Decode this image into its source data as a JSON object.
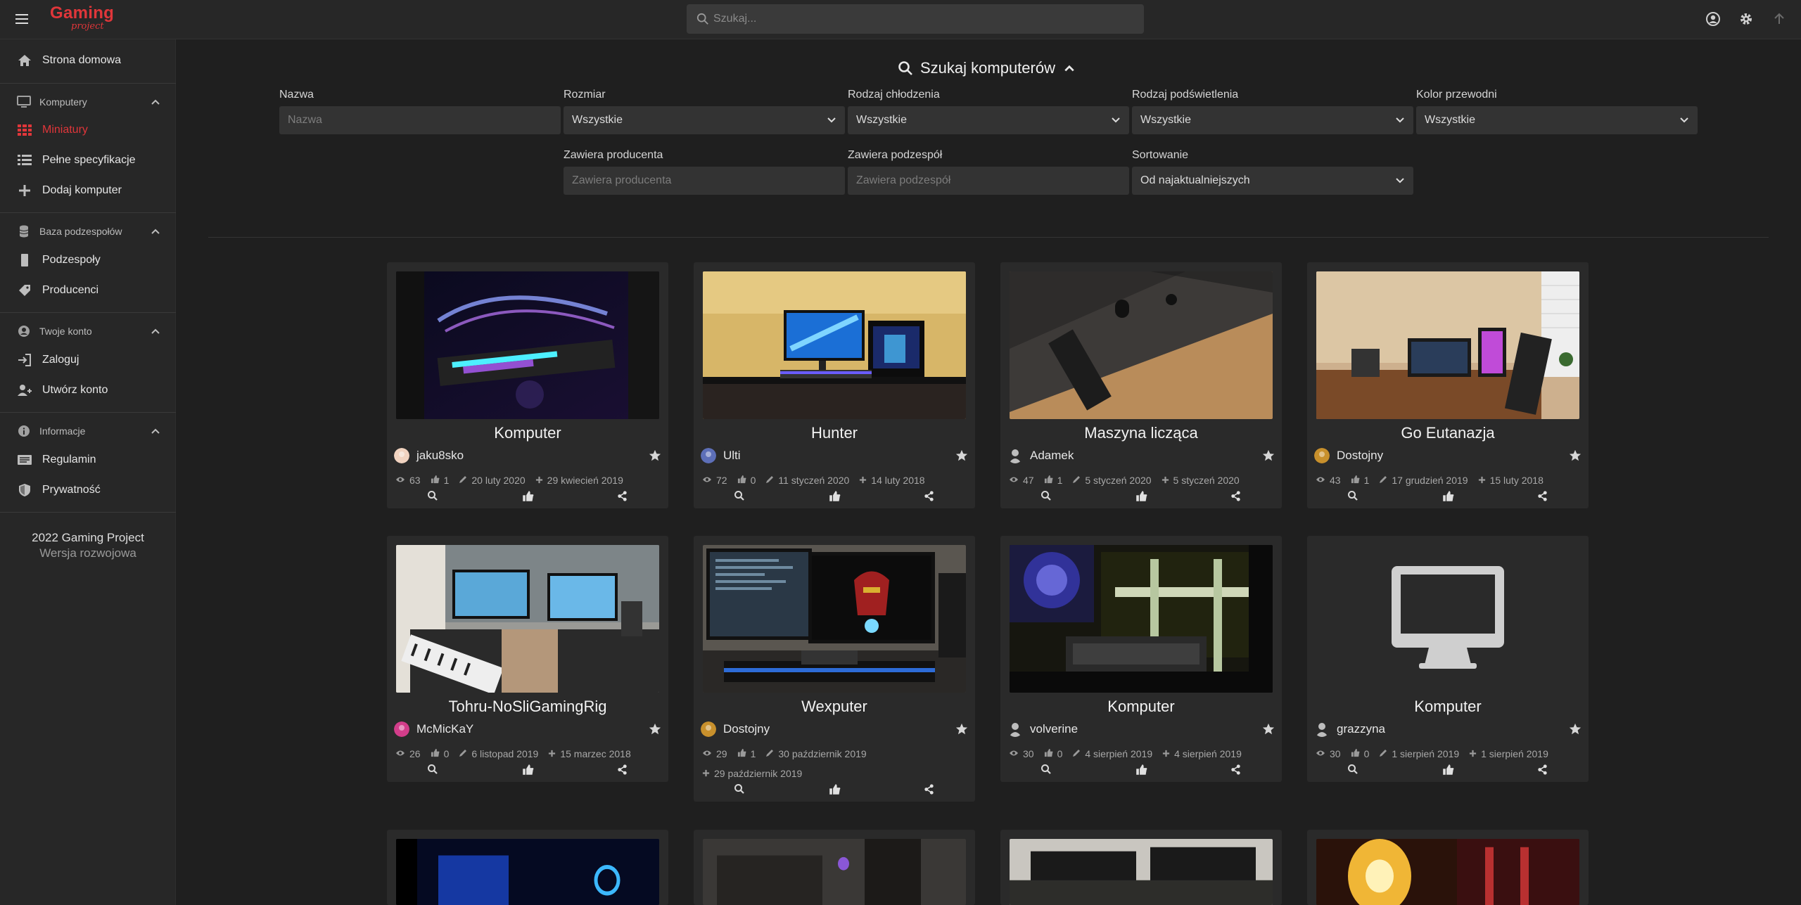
{
  "app": {
    "logo_line1": "Gaming",
    "logo_line2": "project",
    "accent": "#e0363a"
  },
  "search": {
    "placeholder": "Szukaj..."
  },
  "topbar_icons": [
    "user-circle-icon",
    "gear-icon",
    "arrow-up-icon"
  ],
  "sidebar": {
    "home": "Strona domowa",
    "sections": [
      {
        "label": "Komputery",
        "icon": "monitor-icon",
        "items": [
          {
            "label": "Miniatury",
            "icon": "grid-icon",
            "active": true
          },
          {
            "label": "Pełne specyfikacje",
            "icon": "list-icon",
            "active": false
          },
          {
            "label": "Dodaj komputer",
            "icon": "plus-icon",
            "active": false
          }
        ]
      },
      {
        "label": "Baza podzespołów",
        "icon": "database-icon",
        "items": [
          {
            "label": "Podzespoły",
            "icon": "memory-icon",
            "active": false
          },
          {
            "label": "Producenci",
            "icon": "tag-icon",
            "active": false
          }
        ]
      },
      {
        "label": "Twoje konto",
        "icon": "user-circle-icon",
        "items": [
          {
            "label": "Zaloguj",
            "icon": "login-icon",
            "active": false
          },
          {
            "label": "Utwórz konto",
            "icon": "user-plus-icon",
            "active": false
          }
        ]
      },
      {
        "label": "Informacje",
        "icon": "info-icon",
        "items": [
          {
            "label": "Regulamin",
            "icon": "document-icon",
            "active": false
          },
          {
            "label": "Prywatność",
            "icon": "shield-icon",
            "active": false
          }
        ]
      }
    ],
    "footer_line1": "2022 Gaming Project",
    "footer_line2": "Wersja rozwojowa"
  },
  "filters": {
    "title": "Szukaj komputerów",
    "name_label": "Nazwa",
    "name_placeholder": "Nazwa",
    "size_label": "Rozmiar",
    "size_value": "Wszystkie",
    "cooling_label": "Rodzaj chłodzenia",
    "cooling_value": "Wszystkie",
    "lighting_label": "Rodzaj podświetlenia",
    "lighting_value": "Wszystkie",
    "color_label": "Kolor przewodni",
    "color_value": "Wszystkie",
    "manufacturer_label": "Zawiera producenta",
    "manufacturer_placeholder": "Zawiera producenta",
    "component_label": "Zawiera podzespół",
    "component_placeholder": "Zawiera podzespół",
    "sort_label": "Sortowanie",
    "sort_value": "Od najaktualniejszych"
  },
  "cards": [
    {
      "title": "Komputer",
      "author": "jaku8sko",
      "views": "63",
      "likes": "1",
      "edited": "20 luty 2020",
      "created": "29 kwiecień 2019"
    },
    {
      "title": "Hunter",
      "author": "Ulti",
      "views": "72",
      "likes": "0",
      "edited": "11 styczeń 2020",
      "created": "14 luty 2018"
    },
    {
      "title": "Maszyna licząca",
      "author": "Adamek",
      "views": "47",
      "likes": "1",
      "edited": "5 styczeń 2020",
      "created": "5 styczeń 2020"
    },
    {
      "title": "Go Eutanazja",
      "author": "Dostojny",
      "views": "43",
      "likes": "1",
      "edited": "17 grudzień 2019",
      "created": "15 luty 2018"
    },
    {
      "title": "Tohru-NoSliGamingRig",
      "author": "McMicKaY",
      "views": "26",
      "likes": "0",
      "edited": "6 listopad 2019",
      "created": "15 marzec 2018"
    },
    {
      "title": "Wexputer",
      "author": "Dostojny",
      "views": "29",
      "likes": "1",
      "edited": "30 październik 2019",
      "created": "29 październik 2019"
    },
    {
      "title": "Komputer",
      "author": "volverine",
      "views": "30",
      "likes": "0",
      "edited": "4 sierpień 2019",
      "created": "4 sierpień 2019"
    },
    {
      "title": "Komputer",
      "author": "grazzyna",
      "views": "30",
      "likes": "0",
      "edited": "1 sierpień 2019",
      "created": "1 sierpień 2019"
    }
  ]
}
